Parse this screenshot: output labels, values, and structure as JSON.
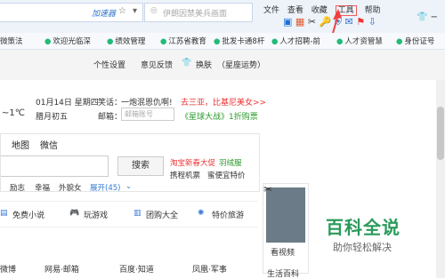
{
  "browser": {
    "address_hint": "加速器",
    "search_placeholder": "伊朗因禁美兵画面",
    "menu": [
      "文件",
      "查看",
      "收藏",
      "工具",
      "帮助"
    ],
    "bookmarks": [
      "微策法",
      "欢迎光临深",
      "绩效管理",
      "江苏省教育",
      "批发卡通8杆",
      "人才招聘-前",
      "人才资管慧",
      "身份证号"
    ]
  },
  "page": {
    "topbar": {
      "settings": "个性设置",
      "feedback": "意见反馈",
      "skin": "换肤",
      "fortune": "（星座运势）"
    },
    "weather": {
      "temp": "~1℃",
      "date": "01月14日 星期四",
      "lunar": "腊月初五",
      "joke_label": "笑话：",
      "joke_text": "一炮泯恩仇啊!",
      "mail_label": "邮箱：",
      "mail_placeholder": "邮箱账号",
      "promo1": "去三亚，比基尼美女>>",
      "promo2": "《星球大战》1折购票"
    },
    "search": {
      "tabs": [
        "地图",
        "微信"
      ],
      "button": "搜索",
      "side_links": [
        "淘宝新春大促",
        "羽绒服",
        "携程机票",
        "蜜便宜特价"
      ],
      "quick": [
        "励志",
        "幸福",
        "外貌女"
      ],
      "expand": "展开(45)"
    },
    "services": [
      "免费小说",
      "玩游戏",
      "团购大全",
      "特价旅游"
    ],
    "links": [
      "微博",
      "网易·邮箱",
      "百度·知道",
      "凤凰·军事"
    ],
    "side": {
      "video": "看视频",
      "baike_small": "生活百科",
      "baike_big": "百科全说",
      "baike_sub": "助你轻松解决"
    }
  }
}
